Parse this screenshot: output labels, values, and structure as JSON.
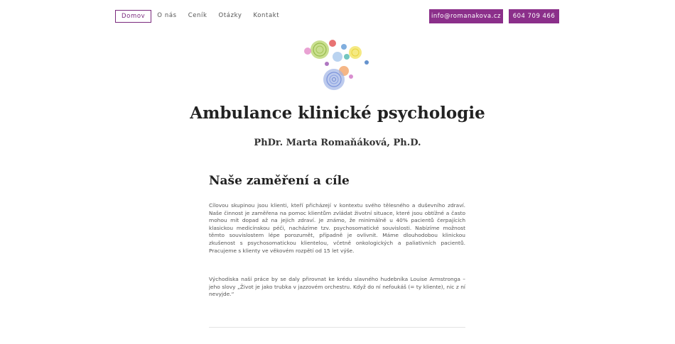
{
  "nav": {
    "items": [
      {
        "label": "Domov",
        "active": true
      },
      {
        "label": "O nás",
        "active": false
      },
      {
        "label": "Ceník",
        "active": false
      },
      {
        "label": "Otázky",
        "active": false
      },
      {
        "label": "Kontakt",
        "active": false
      }
    ]
  },
  "contact": {
    "email": "info@romanakova.cz",
    "phone": "604 709 466"
  },
  "colors": {
    "accent": "#8b2f8a",
    "active_border": "#7a2a7d",
    "text": "#333333"
  },
  "header": {
    "title": "Ambulance klinické psychologie",
    "subtitle": "PhDr. Marta Romaňáková, Ph.D."
  },
  "main": {
    "section_title": "Naše zaměření a cíle",
    "paragraph_1": "Cílovou skupinou jsou klienti, kteří přicházejí v kontextu svého tělesného a duševního zdraví. Naše činnost je zaměřena na pomoc klientům zvládat životní situace, které jsou obtížné a často mohou mít dopad až na jejich zdraví. Je známo, že minimálně u 40% pacientů čerpajících klasickou medicínskou péči, nacházíme tzv. psychosomatické souvislosti. Nabízíme možnost těmto souvislostem lépe porozumět, případně je ovlivnit. Máme dlouhodobou klinickou zkušenost s psychosomatickou klientelou, včetně onkologických a paliativních pacientů. Pracujeme s klienty ve věkovém rozpětí od 15 let výše.",
    "paragraph_2": "Východiska naší práce by se daly přirovnat ke krédu slavného hudebníka Louise Armstronga – jeho slovy „Život je jako trubka v jazzovém orchestru. Když do ní nefoukáš (= ty kliente), nic z ní nevyjde.“"
  }
}
